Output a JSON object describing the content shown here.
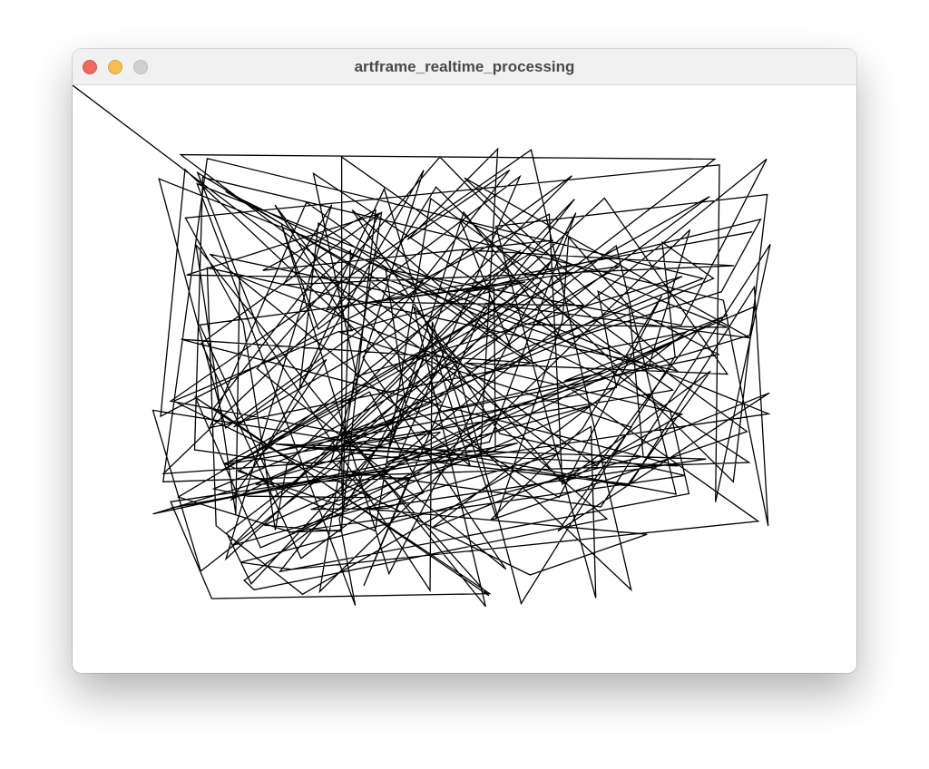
{
  "window": {
    "title": "artframe_realtime_processing",
    "controls": {
      "close": "close-icon",
      "minimize": "minimize-icon",
      "zoom": "zoom-icon"
    },
    "colors": {
      "titlebar": "#f2f1f2",
      "close": "#ec6a5e",
      "minimize": "#f4bf4f",
      "zoom": "#d1d0d1"
    }
  },
  "canvas": {
    "background": "#ffffff",
    "stroke": "#000000",
    "content": "polyline-scribble"
  }
}
